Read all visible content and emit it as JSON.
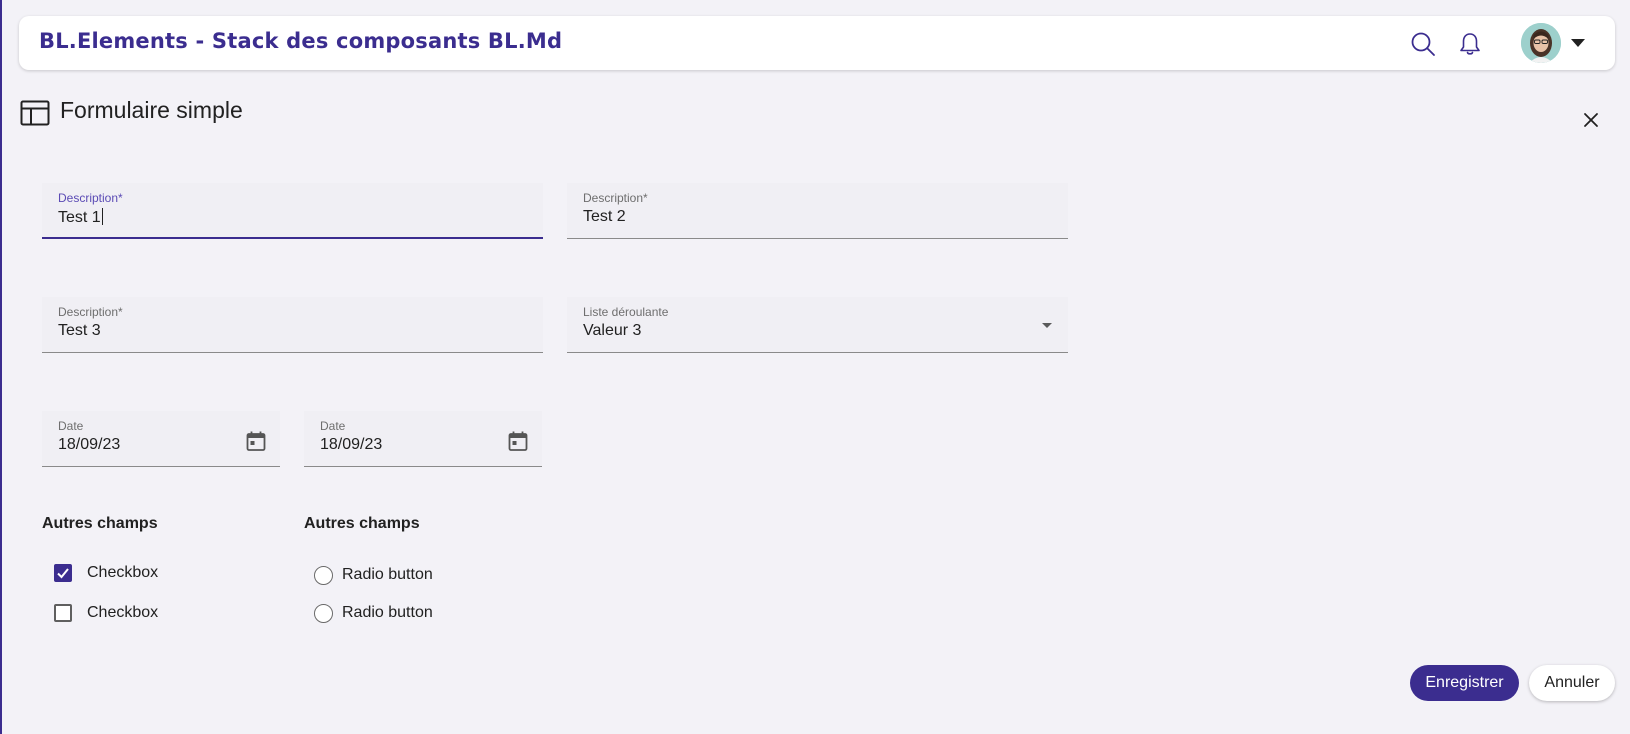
{
  "header": {
    "title": "BL.Elements - Stack des composants BL.Md",
    "icons": {
      "search": "search-icon",
      "notifications": "bell-icon",
      "menu": "caret-down-icon"
    }
  },
  "page": {
    "title": "Formulaire simple",
    "title_icon": "table-layout-icon",
    "close_icon": "close-icon"
  },
  "fields": {
    "description1": {
      "label": "Description*",
      "value": "Test 1"
    },
    "description2": {
      "label": "Description*",
      "value": "Test 2"
    },
    "description3": {
      "label": "Description*",
      "value": "Test 3"
    },
    "dropdown": {
      "label": "Liste déroulante",
      "value": "Valeur 3"
    },
    "date1": {
      "label": "Date",
      "value": "18/09/23"
    },
    "date2": {
      "label": "Date",
      "value": "18/09/23"
    }
  },
  "checkbox_group": {
    "title": "Autres champs",
    "items": [
      {
        "label": "Checkbox",
        "checked": true
      },
      {
        "label": "Checkbox",
        "checked": false
      }
    ]
  },
  "radio_group": {
    "title": "Autres champs",
    "items": [
      {
        "label": "Radio button",
        "selected": false
      },
      {
        "label": "Radio button",
        "selected": false
      }
    ]
  },
  "actions": {
    "save_label": "Enregistrer",
    "cancel_label": "Annuler"
  },
  "colors": {
    "accent": "#3b2d8f",
    "background": "#f3f2f7",
    "field_bg": "#f0eff4"
  }
}
